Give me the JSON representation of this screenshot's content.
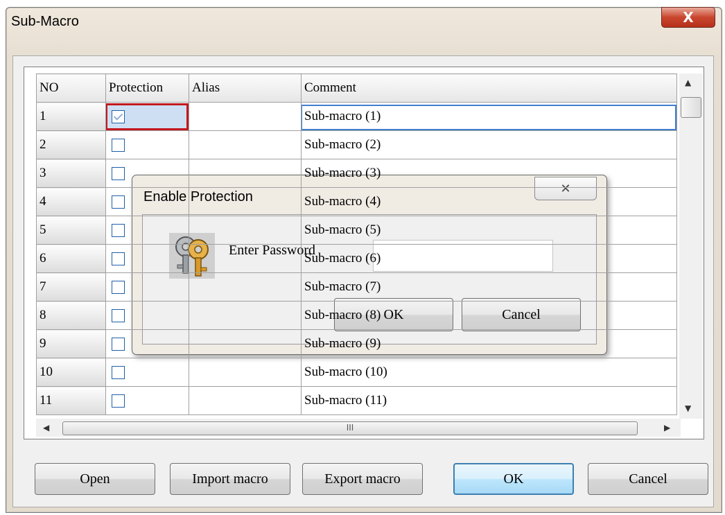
{
  "window": {
    "title": "Sub-Macro",
    "close_glyph": "X"
  },
  "table": {
    "headers": [
      "NO",
      "Protection",
      "Alias",
      "Comment"
    ],
    "rows": [
      {
        "no": "1",
        "checked": true,
        "alias": "",
        "comment": "Sub-macro (1)"
      },
      {
        "no": "2",
        "checked": false,
        "alias": "",
        "comment": "Sub-macro (2)"
      },
      {
        "no": "3",
        "checked": false,
        "alias": "",
        "comment": "Sub-macro (3)"
      },
      {
        "no": "4",
        "checked": false,
        "alias": "",
        "comment": "Sub-macro (4)"
      },
      {
        "no": "5",
        "checked": false,
        "alias": "",
        "comment": "Sub-macro (5)"
      },
      {
        "no": "6",
        "checked": false,
        "alias": "",
        "comment": "Sub-macro (6)"
      },
      {
        "no": "7",
        "checked": false,
        "alias": "",
        "comment": "Sub-macro (7)"
      },
      {
        "no": "8",
        "checked": false,
        "alias": "",
        "comment": "Sub-macro (8)"
      },
      {
        "no": "9",
        "checked": false,
        "alias": "",
        "comment": "Sub-macro (9)"
      },
      {
        "no": "10",
        "checked": false,
        "alias": "",
        "comment": "Sub-macro (10)"
      },
      {
        "no": "11",
        "checked": false,
        "alias": "",
        "comment": "Sub-macro (11)"
      }
    ]
  },
  "scrollbar": {
    "hthumb_glyph": "III"
  },
  "buttons": {
    "open": "Open",
    "import": "Import macro",
    "export": "Export macro",
    "ok": "OK",
    "cancel": "Cancel"
  },
  "dialog": {
    "title": "Enable Protection",
    "close_glyph": "✕",
    "label": "Enter Password",
    "password_value": "",
    "ok": "OK",
    "cancel": "Cancel",
    "icon": "keys-icon"
  },
  "colors": {
    "selection_border": "#c2181f",
    "accent": "#3c7fb1"
  }
}
